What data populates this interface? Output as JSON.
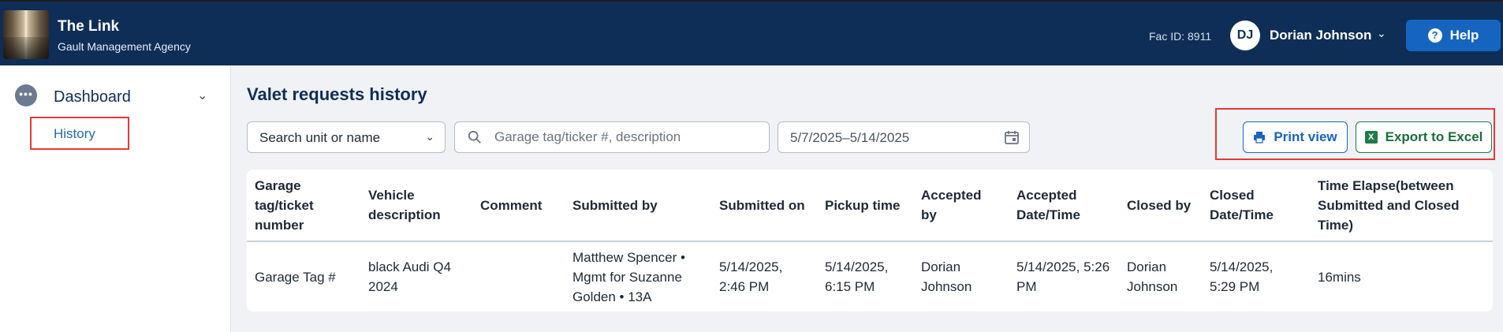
{
  "header": {
    "app_title": "The Link",
    "app_subtitle": "Gault Management Agency",
    "fac_id": "Fac ID: 8911",
    "user_initials": "DJ",
    "user_name": "Dorian Johnson",
    "help_label": "Help"
  },
  "sidebar": {
    "dashboard_label": "Dashboard",
    "history_label": "History"
  },
  "main": {
    "title": "Valet requests history",
    "unit_select_value": "Search unit or name",
    "search_placeholder": "Garage tag/ticker #, description",
    "date_range": "5/7/2025–5/14/2025",
    "print_label": "Print view",
    "excel_label": "Export to Excel",
    "excel_icon_letter": "X"
  },
  "table": {
    "columns": [
      "Garage tag/ticket number",
      "Vehicle description",
      "Comment",
      "Submitted by",
      "Submitted on",
      "Pickup time",
      "Accepted by",
      "Accepted Date/Time",
      "Closed by",
      "Closed Date/Time",
      "Time Elapse(between Submitted and Closed Time)"
    ],
    "rows": [
      [
        "Garage Tag #",
        "black Audi Q4 2024",
        "",
        "Matthew Spencer • Mgmt for Suzanne Golden • 13A",
        "5/14/2025, 2:46 PM",
        "5/14/2025, 6:15 PM",
        "Dorian Johnson",
        "5/14/2025, 5:26 PM",
        "Dorian Johnson",
        "5/14/2025, 5:29 PM",
        "16mins"
      ]
    ]
  },
  "colors": {
    "header_bg": "#0f2e57",
    "accent_blue": "#1565c0",
    "excel_green": "#1e7a47",
    "highlight_red": "#e53935"
  },
  "icons": {
    "dashboard": "dots-icon",
    "search": "search-icon",
    "calendar": "calendar-icon",
    "print": "printer-icon",
    "excel": "excel-icon",
    "help": "help-icon"
  }
}
